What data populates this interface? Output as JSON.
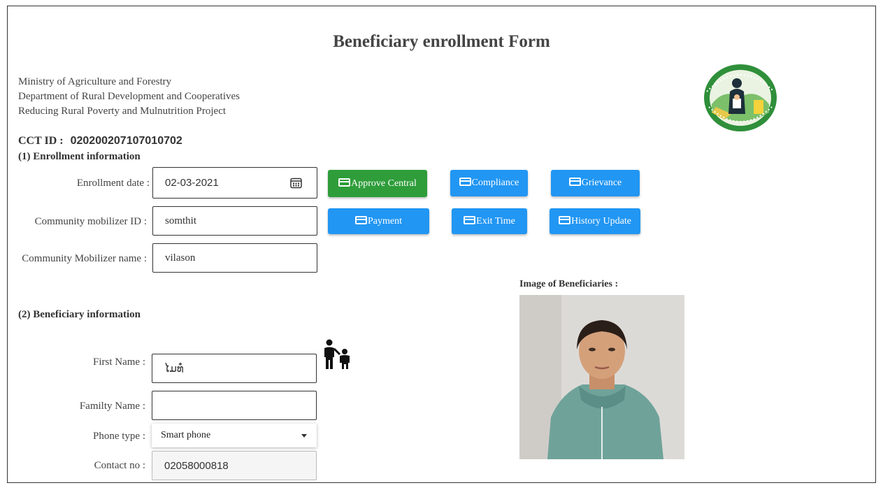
{
  "page": {
    "title": "Beneficiary enrollment Form",
    "org_lines": [
      "Ministry of Agriculture and Forestry",
      "Department of Rural Development and Cooperatives",
      "Reducing Rural Poverty and Mulnutrition Project"
    ],
    "cct_label": "CCT ID :",
    "cct_value": "020200207107010702"
  },
  "enrollment": {
    "heading": "(1) Enrollment information",
    "date_label": "Enrollment date :",
    "date_value": "02-03-2021",
    "mobilizer_id_label": "Community mobilizer ID :",
    "mobilizer_id_value": "somthit",
    "mobilizer_name_label": "Community Mobilizer name :",
    "mobilizer_name_value": "vilason"
  },
  "actions": {
    "approve_central": "Approve Central",
    "compliance": "Compliance",
    "grievance": "Grievance",
    "payment": "Payment",
    "exit_time": "Exit Time",
    "history_update": "History Update"
  },
  "beneficiary": {
    "heading": "(2) Beneficiary information",
    "first_name_label": "First Name :",
    "first_name_value": "ໄມທ໋",
    "family_name_label": "Familty Name :",
    "family_name_value": "",
    "phone_type_label": "Phone type :",
    "phone_type_value": "Smart phone",
    "contact_label": "Contact no :",
    "contact_value": "02058000818",
    "image_label": "Image of Beneficiaries :"
  },
  "icons": {
    "calendar": "calendar-icon",
    "card": "credit-card-icon",
    "family": "parent-child-icon",
    "dropdown": "caret-down-icon",
    "logo": "project-logo"
  },
  "colors": {
    "primary_blue": "#2196f3",
    "success_green": "#2e9d3a",
    "logo_green": "#2f8f3a"
  }
}
